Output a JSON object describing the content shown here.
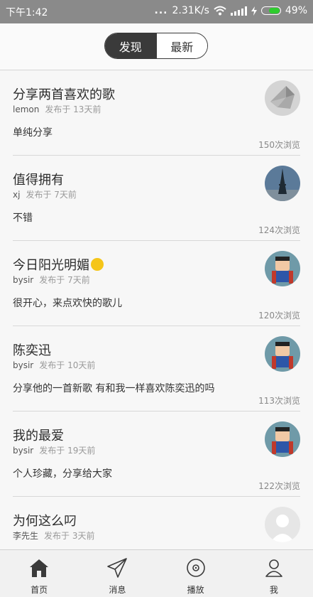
{
  "status": {
    "time": "下午1:42",
    "dots": "...",
    "speed": "2.31K/s",
    "battery": "49%"
  },
  "tabs": {
    "discover": "发现",
    "latest": "最新"
  },
  "posts": [
    {
      "title": "分享两首喜欢的歌",
      "author": "lemon",
      "time": "发布于 13天前",
      "body": "单纯分享",
      "views": "150次浏览",
      "avatar_icon": "origami-avatar"
    },
    {
      "title": "值得拥有",
      "author": "xj",
      "time": "发布于 7天前",
      "body": "不错",
      "views": "124次浏览",
      "avatar_icon": "tower-avatar"
    },
    {
      "title": "今日阳光明媚",
      "author": "bysir",
      "time": "发布于 7天前",
      "body": "很开心，来点欢快的歌儿",
      "views": "120次浏览",
      "avatar_icon": "superhero-avatar"
    },
    {
      "title": "陈奕迅",
      "author": "bysir",
      "time": "发布于 10天前",
      "body": "分享他的一首新歌 有和我一样喜欢陈奕迅的吗",
      "views": "113次浏览",
      "avatar_icon": "superhero-avatar"
    },
    {
      "title": "我的最爱",
      "author": "bysir",
      "time": "发布于 19天前",
      "body": "个人珍藏，分享给大家",
      "views": "122次浏览",
      "avatar_icon": "superhero-avatar"
    },
    {
      "title": "为何这么叼",
      "author": "李先生",
      "time": "发布于 3天前",
      "body": "",
      "views": "",
      "avatar_icon": "default-avatar"
    }
  ],
  "nav": {
    "home": "首页",
    "messages": "消息",
    "play": "播放",
    "me": "我"
  },
  "colors": {
    "statusbar": "#8a8a8a",
    "segment_active": "#3a3a3a",
    "battery": "#2ecc2e"
  }
}
